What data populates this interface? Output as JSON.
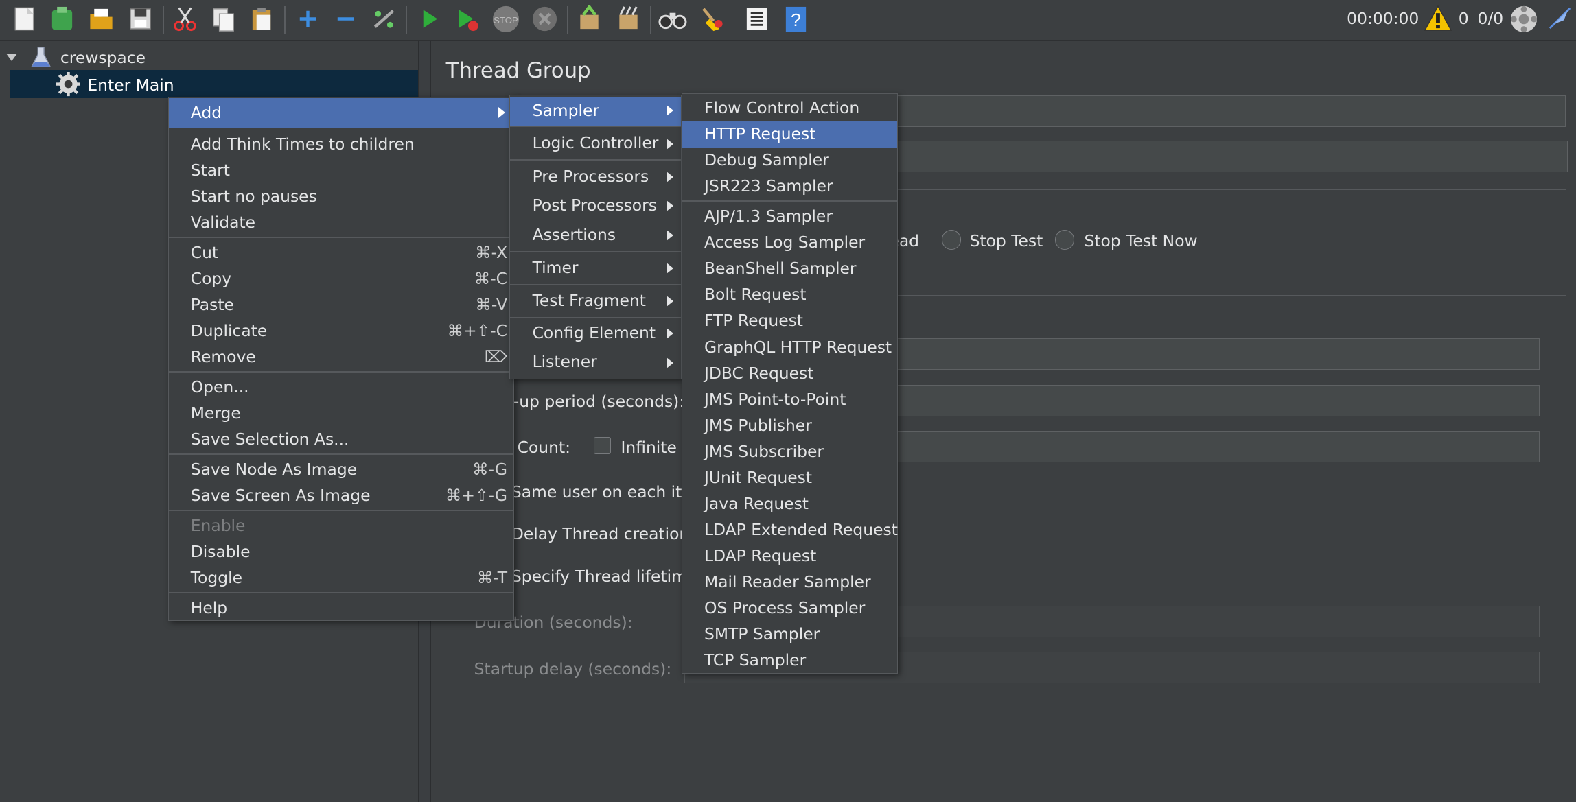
{
  "toolbar": {
    "elapsed": "00:00:00",
    "warning_count": "0",
    "thread_ratio": "0/0"
  },
  "tree": {
    "root_label": "crewspace",
    "child_label": "Enter Main"
  },
  "panel": {
    "title": "Thread Group",
    "rampup_label": "-up period (seconds):",
    "loop_label": "Count:",
    "infinite_label": "Infinite",
    "same_user_label": "Same user on each itera",
    "delay_label": "Delay Thread creation u",
    "lifetime_label": "Specify Thread lifetime",
    "duration_label": "Duration (seconds):",
    "startup_label": "Startup delay (seconds):",
    "after_error_partial": "ead",
    "stop_test_label": "Stop Test",
    "stop_test_now_label": "Stop Test Now"
  },
  "context_menu": {
    "add": "Add",
    "add_think": "Add Think Times to children",
    "start": "Start",
    "start_no_pauses": "Start no pauses",
    "validate": "Validate",
    "cut": "Cut",
    "cut_sc": "⌘-X",
    "copy": "Copy",
    "copy_sc": "⌘-C",
    "paste": "Paste",
    "paste_sc": "⌘-V",
    "duplicate": "Duplicate",
    "duplicate_sc": "⌘+⇧-C",
    "remove": "Remove",
    "remove_sc": "⌦",
    "open": "Open...",
    "merge": "Merge",
    "save_selection": "Save Selection As...",
    "save_node_image": "Save Node As Image",
    "save_node_image_sc": "⌘-G",
    "save_screen_image": "Save Screen As Image",
    "save_screen_image_sc": "⌘+⇧-G",
    "enable": "Enable",
    "disable": "Disable",
    "toggle": "Toggle",
    "toggle_sc": "⌘-T",
    "help": "Help"
  },
  "add_menu": {
    "sampler": "Sampler",
    "logic_controller": "Logic Controller",
    "pre_processors": "Pre Processors",
    "post_processors": "Post Processors",
    "assertions": "Assertions",
    "timer": "Timer",
    "test_fragment": "Test Fragment",
    "config_element": "Config Element",
    "listener": "Listener"
  },
  "sampler_menu": {
    "flow_control": "Flow Control Action",
    "http_request": "HTTP Request",
    "debug_sampler": "Debug Sampler",
    "jsr223": "JSR223 Sampler",
    "ajp": "AJP/1.3 Sampler",
    "access_log": "Access Log Sampler",
    "beanshell": "BeanShell Sampler",
    "bolt": "Bolt Request",
    "ftp": "FTP Request",
    "graphql": "GraphQL HTTP Request",
    "jdbc": "JDBC Request",
    "jms_p2p": "JMS Point-to-Point",
    "jms_pub": "JMS Publisher",
    "jms_sub": "JMS Subscriber",
    "junit": "JUnit Request",
    "java": "Java Request",
    "ldap_ext": "LDAP Extended Request",
    "ldap": "LDAP Request",
    "mail_reader": "Mail Reader Sampler",
    "os_process": "OS Process Sampler",
    "smtp": "SMTP Sampler",
    "tcp": "TCP Sampler"
  },
  "colors": {
    "selection": "#4b6eaf",
    "background": "#3c3f41"
  }
}
